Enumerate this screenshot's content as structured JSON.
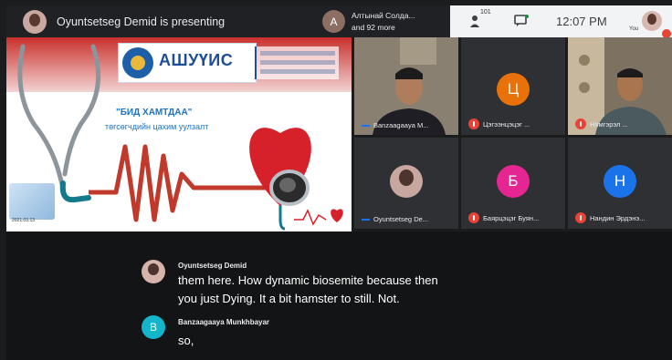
{
  "topbar": {
    "presenting_text": "Oyuntsetseg Demid is presenting",
    "others_initial": "A",
    "others_line1": "Алтынай Солда...",
    "others_line2": "and 92 more",
    "participants_count": "101",
    "clock": "12:07 PM",
    "you_label": "You"
  },
  "slide": {
    "logo_text": "АШУҮИС",
    "title_line1": "\"БИД ХАМТДАА\"",
    "title_line2": "төгсөгчдийн цахим уулзалт",
    "date": "2021.03.13"
  },
  "participants": [
    {
      "name": "Banzaagaaya M...",
      "initial": "",
      "color": "",
      "muted": false
    },
    {
      "name": "Цэгээнцэцэг ...",
      "initial": "Ц",
      "color": "#e8710a",
      "muted": true
    },
    {
      "name": "Нямгэрэл ...",
      "initial": "",
      "color": "",
      "muted": true
    },
    {
      "name": "Oyuntsetseg De...",
      "initial": "",
      "color": "",
      "muted": false
    },
    {
      "name": "Баярцэцэг Буян...",
      "initial": "Б",
      "color": "#e52592",
      "muted": true
    },
    {
      "name": "Нандин Эрдэнэ...",
      "initial": "Н",
      "color": "#1a73e8",
      "muted": true
    }
  ],
  "chat": {
    "msg1": {
      "name": "Oyuntsetseg Demid",
      "line1": "them here. How dynamic biosemite because then",
      "line2": "you just Dying. It a bit hamster to still. Not."
    },
    "msg2": {
      "initial": "B",
      "name": "Banzaagaaya Munkhbayar",
      "text": "so,"
    }
  }
}
